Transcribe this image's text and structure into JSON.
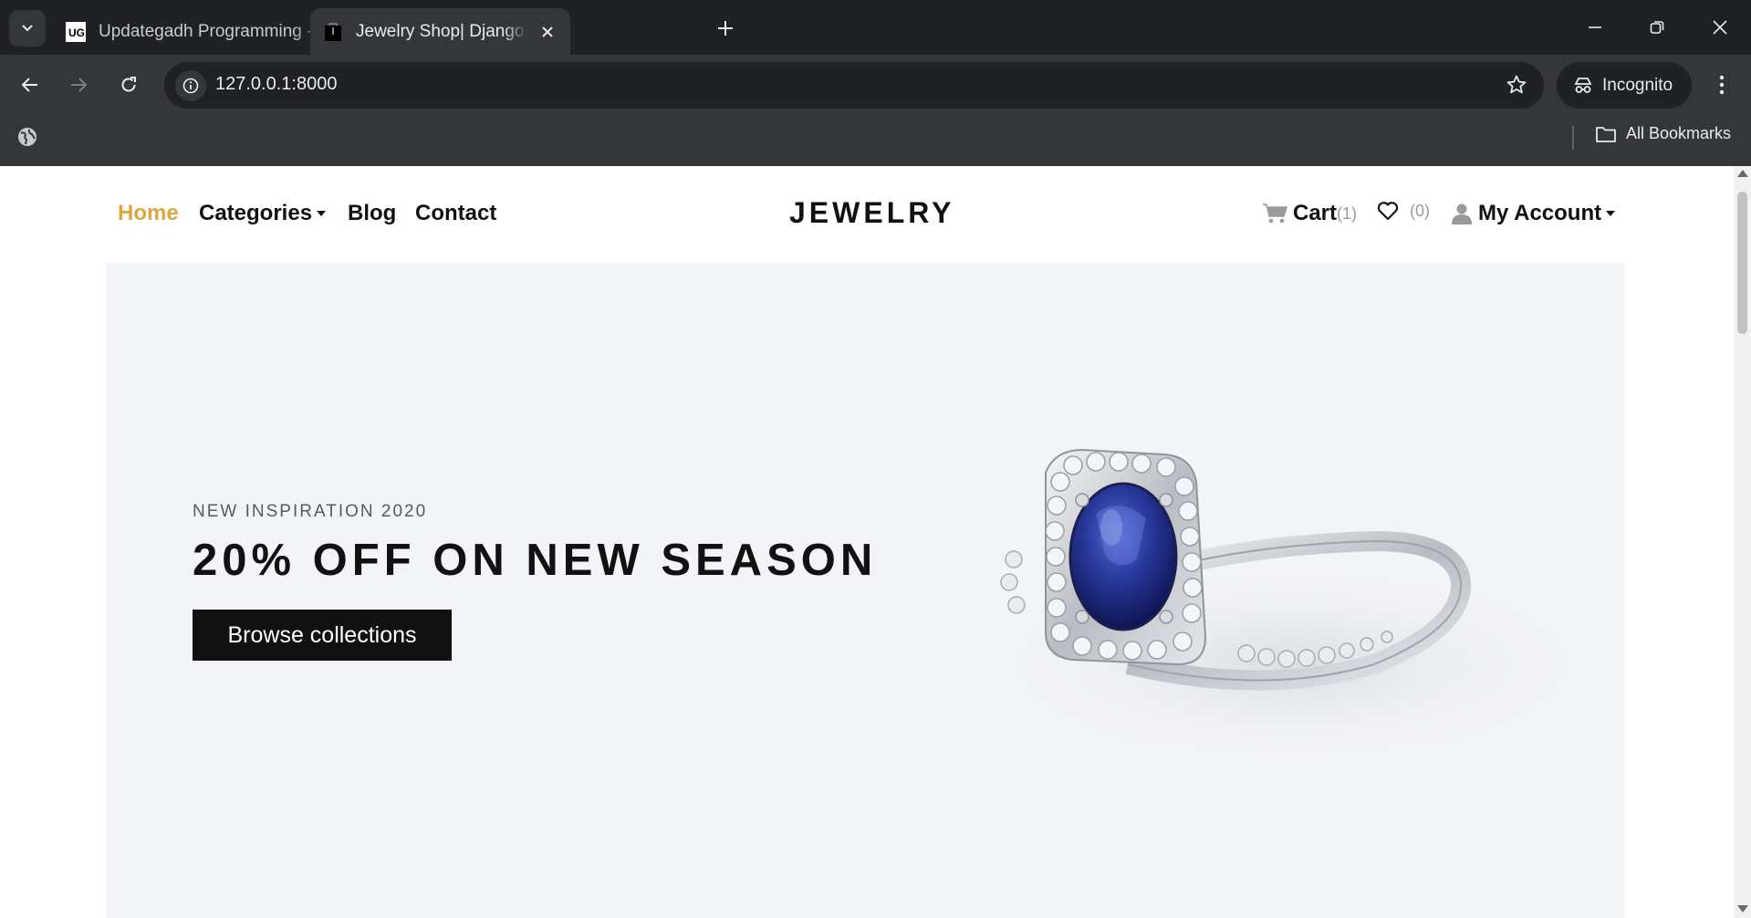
{
  "browser": {
    "tabs": [
      {
        "title": "Updategadh Programming - Up",
        "favicon": "updategadh-icon",
        "active": false
      },
      {
        "title": "Jewelry Shop| Django Ecommer",
        "favicon": "shopping-bag-icon",
        "active": true
      }
    ],
    "url": "127.0.0.1:8000",
    "profile_label": "Incognito",
    "bookmarks_label": "All Bookmarks"
  },
  "nav": {
    "left": [
      {
        "label": "Home",
        "active": true
      },
      {
        "label": "Categories",
        "dropdown": true
      },
      {
        "label": "Blog"
      },
      {
        "label": "Contact"
      }
    ],
    "brand": "JEWELRY",
    "cart": {
      "label": "Cart",
      "count": "(1)"
    },
    "wishlist": {
      "count": "(0)"
    },
    "account": {
      "label": "My Account",
      "dropdown": true
    },
    "accent_color": "#d9a93c"
  },
  "hero": {
    "subtitle": "NEW INSPIRATION 2020",
    "title": "20% OFF ON NEW SEASON",
    "button_label": "Browse collections",
    "image": "sapphire-ring-image",
    "background_color": "#f3f4f8"
  }
}
